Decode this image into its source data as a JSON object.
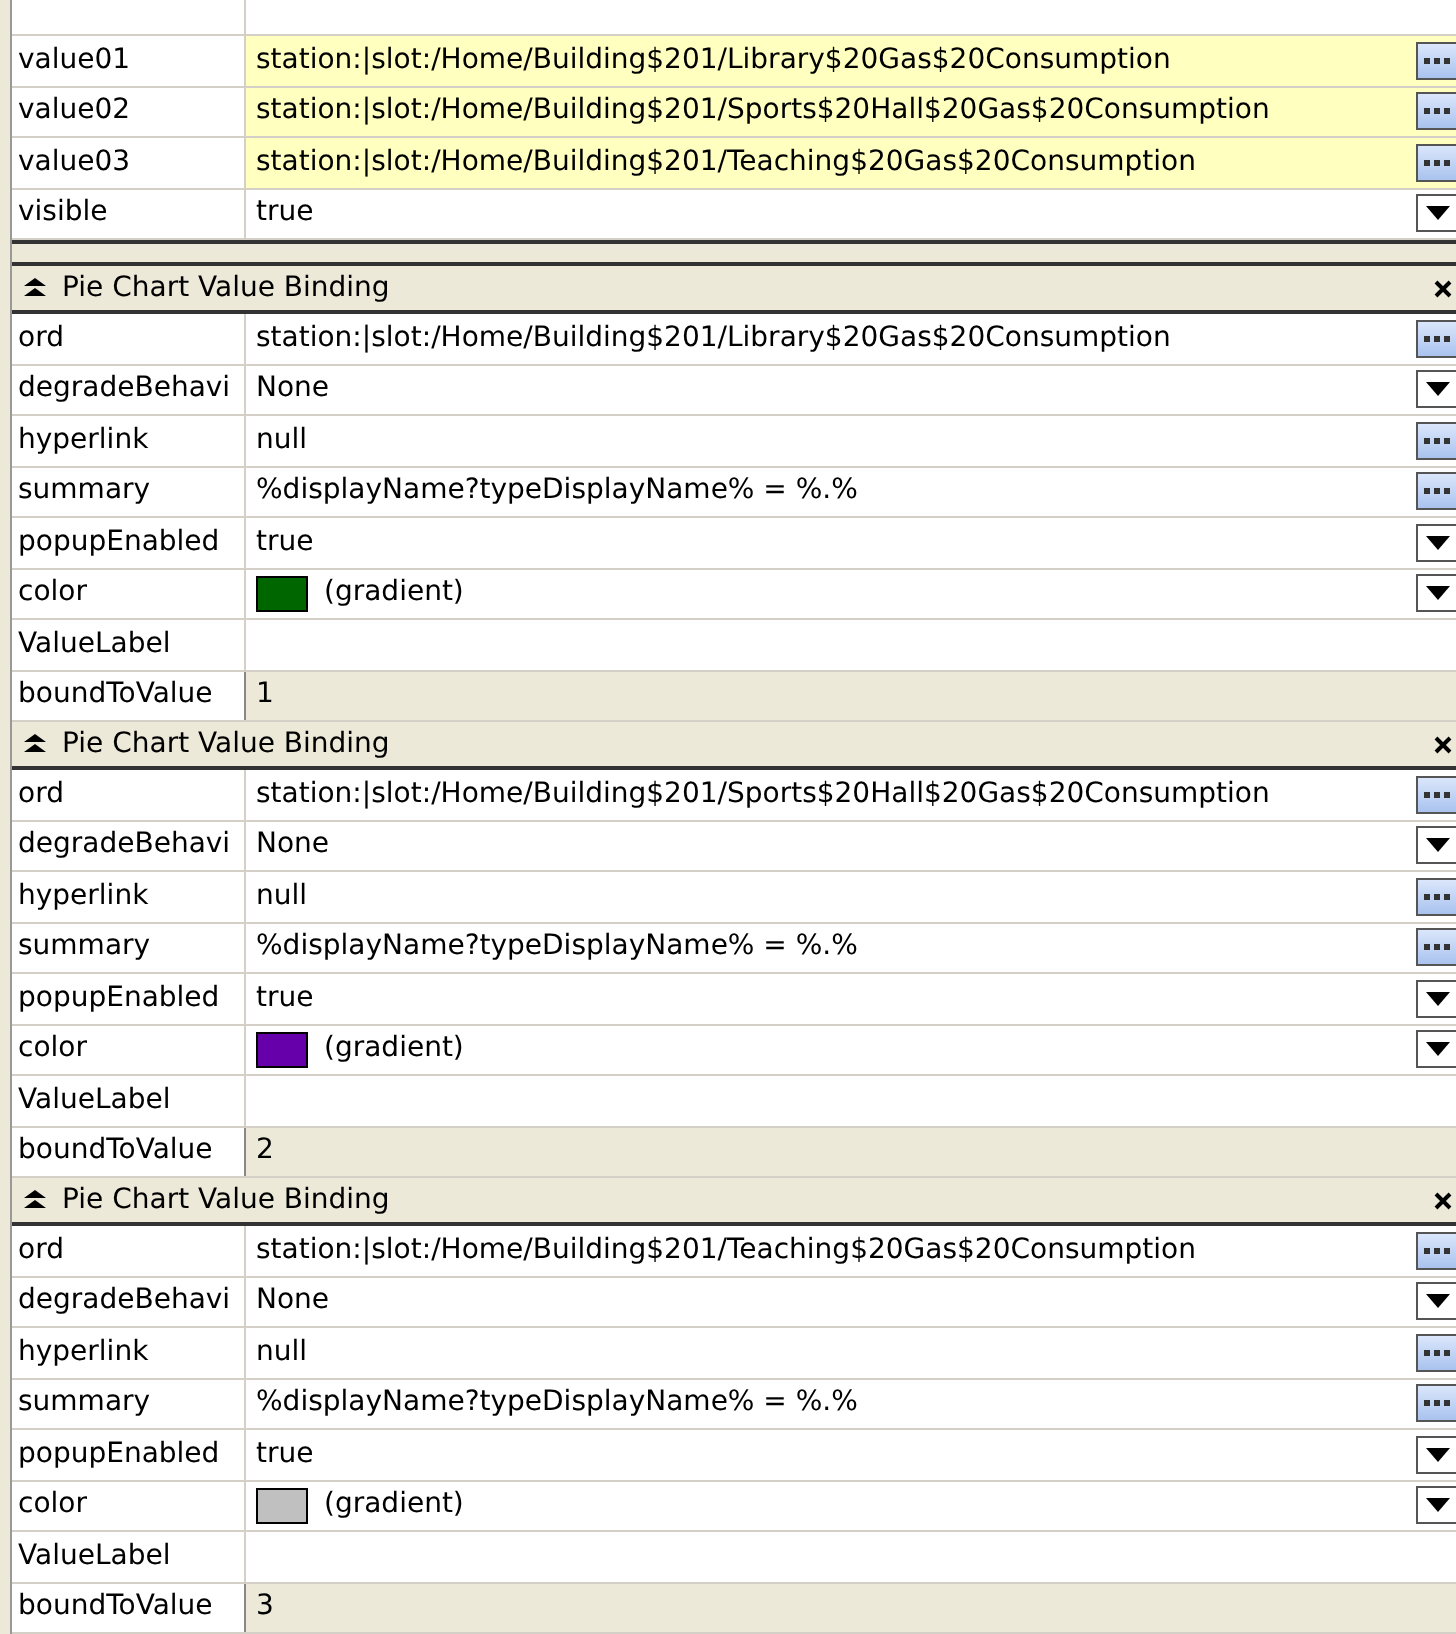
{
  "top_rows": [
    {
      "name": "value01",
      "value": "station:|slot:/Home/Building$201/Library$20Gas$20Consumption",
      "highlighted": true,
      "kind": "ellipsis"
    },
    {
      "name": "value02",
      "value": "station:|slot:/Home/Building$201/Sports$20Hall$20Gas$20Consumption",
      "highlighted": true,
      "kind": "ellipsis"
    },
    {
      "name": "value03",
      "value": "station:|slot:/Home/Building$201/Teaching$20Gas$20Consumption",
      "highlighted": true,
      "kind": "ellipsis"
    },
    {
      "name": "visible",
      "value": "true",
      "highlighted": false,
      "kind": "dropdown"
    }
  ],
  "sections": [
    {
      "title": "Pie Chart Value Binding",
      "rows": [
        {
          "name": "ord",
          "value": "station:|slot:/Home/Building$201/Library$20Gas$20Consumption",
          "kind": "ellipsis",
          "readonly": false
        },
        {
          "name": "degradeBehavi",
          "value": "None",
          "kind": "dropdown",
          "readonly": false
        },
        {
          "name": "hyperlink",
          "value": "null",
          "kind": "ellipsis",
          "readonly": false
        },
        {
          "name": "summary",
          "value": "%displayName?typeDisplayName% = %.%",
          "kind": "ellipsis",
          "readonly": false
        },
        {
          "name": "popupEnabled",
          "value": "true",
          "kind": "dropdown",
          "readonly": false
        },
        {
          "name": "color",
          "value": "(gradient)",
          "kind": "dropdown",
          "readonly": false,
          "color": "#006600"
        },
        {
          "name": "ValueLabel",
          "kind": "none",
          "readonly": false
        },
        {
          "name": "boundToValue",
          "value": "1",
          "kind": "none",
          "readonly": true
        }
      ]
    },
    {
      "title": "Pie Chart Value Binding",
      "rows": [
        {
          "name": "ord",
          "value": "station:|slot:/Home/Building$201/Sports$20Hall$20Gas$20Consumption",
          "kind": "ellipsis",
          "readonly": false
        },
        {
          "name": "degradeBehavi",
          "value": "None",
          "kind": "dropdown",
          "readonly": false
        },
        {
          "name": "hyperlink",
          "value": "null",
          "kind": "ellipsis",
          "readonly": false
        },
        {
          "name": "summary",
          "value": "%displayName?typeDisplayName% = %.%",
          "kind": "ellipsis",
          "readonly": false
        },
        {
          "name": "popupEnabled",
          "value": "true",
          "kind": "dropdown",
          "readonly": false
        },
        {
          "name": "color",
          "value": "(gradient)",
          "kind": "dropdown",
          "readonly": false,
          "color": "#6600aa"
        },
        {
          "name": "ValueLabel",
          "kind": "none",
          "readonly": false
        },
        {
          "name": "boundToValue",
          "value": "2",
          "kind": "none",
          "readonly": true
        }
      ]
    },
    {
      "title": "Pie Chart Value Binding",
      "rows": [
        {
          "name": "ord",
          "value": "station:|slot:/Home/Building$201/Teaching$20Gas$20Consumption",
          "kind": "ellipsis",
          "readonly": false
        },
        {
          "name": "degradeBehavi",
          "value": "None",
          "kind": "dropdown",
          "readonly": false
        },
        {
          "name": "hyperlink",
          "value": "null",
          "kind": "ellipsis",
          "readonly": false
        },
        {
          "name": "summary",
          "value": "%displayName?typeDisplayName% = %.%",
          "kind": "ellipsis",
          "readonly": false
        },
        {
          "name": "popupEnabled",
          "value": "true",
          "kind": "dropdown",
          "readonly": false
        },
        {
          "name": "color",
          "value": "(gradient)",
          "kind": "dropdown",
          "readonly": false,
          "color": "#c0c0c0"
        },
        {
          "name": "ValueLabel",
          "kind": "none",
          "readonly": false
        },
        {
          "name": "boundToValue",
          "value": "3",
          "kind": "none",
          "readonly": true
        }
      ]
    }
  ]
}
